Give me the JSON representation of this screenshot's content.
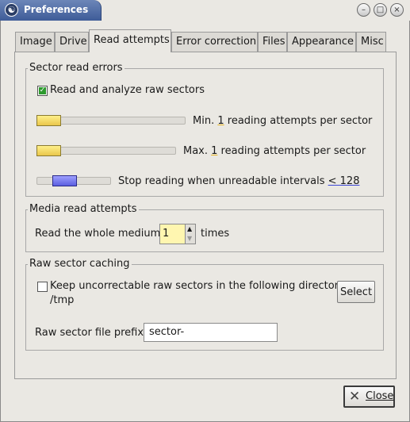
{
  "window": {
    "title": "Preferences",
    "buttons": {
      "minimize": "–",
      "maximize": "□",
      "close": "×"
    }
  },
  "tabs": [
    {
      "label": "Image",
      "active": false
    },
    {
      "label": "Drive",
      "active": false
    },
    {
      "label": "Read attempts",
      "active": true
    },
    {
      "label": "Error correction",
      "active": false
    },
    {
      "label": "Files",
      "active": false
    },
    {
      "label": "Appearance",
      "active": false
    },
    {
      "label": "Misc",
      "active": false
    }
  ],
  "sector_read_errors": {
    "legend": "Sector read errors",
    "raw_checkbox_label": "Read and analyze raw sectors",
    "raw_checked": true,
    "min_pre": "Min. ",
    "min_value": "1",
    "min_post": " reading attempts per sector",
    "max_pre": "Max. ",
    "max_value": "1",
    "max_post": " reading attempts per sector",
    "stop_pre": "Stop reading when unreadable intervals ",
    "stop_value": "< 128"
  },
  "media_read_attempts": {
    "legend": "Media read attempts",
    "pre": "Read the whole medium",
    "value": "1",
    "post": "times"
  },
  "raw_sector_caching": {
    "legend": "Raw sector caching",
    "keep_label": "Keep uncorrectable raw sectors in the following directory:",
    "keep_checked": false,
    "directory": "/tmp",
    "select_label": "Select",
    "prefix_label": "Raw sector file prefix:",
    "prefix_value": "sector-"
  },
  "footer": {
    "close_label": "Close"
  }
}
